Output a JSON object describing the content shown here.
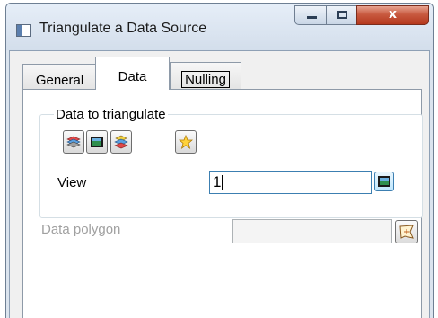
{
  "window": {
    "title": "Triangulate a Data Source"
  },
  "title_controls": {
    "minimize": "minimize-icon",
    "maximize": "maximize-icon",
    "close": "close-icon",
    "close_glyph": "x"
  },
  "tabs": [
    {
      "label": "General",
      "selected": false
    },
    {
      "label": "Data",
      "selected": true
    },
    {
      "label": "Nulling",
      "selected": false,
      "focused": true
    }
  ],
  "data_group": {
    "label": "Data to triangulate",
    "toolbar_icons": [
      "layers-icon",
      "view-icon",
      "stacked-layers-icon",
      "star-icon"
    ]
  },
  "view": {
    "label": "View",
    "value": "1",
    "button_icon": "view-icon"
  },
  "polygon": {
    "label": "Data polygon",
    "value": "",
    "enabled": false,
    "button_icon": "polygon-pick-icon"
  },
  "colors": {
    "accent": "#3c7fb1",
    "disabled_text": "#a0a0a0",
    "close_button": "#c85a40"
  }
}
